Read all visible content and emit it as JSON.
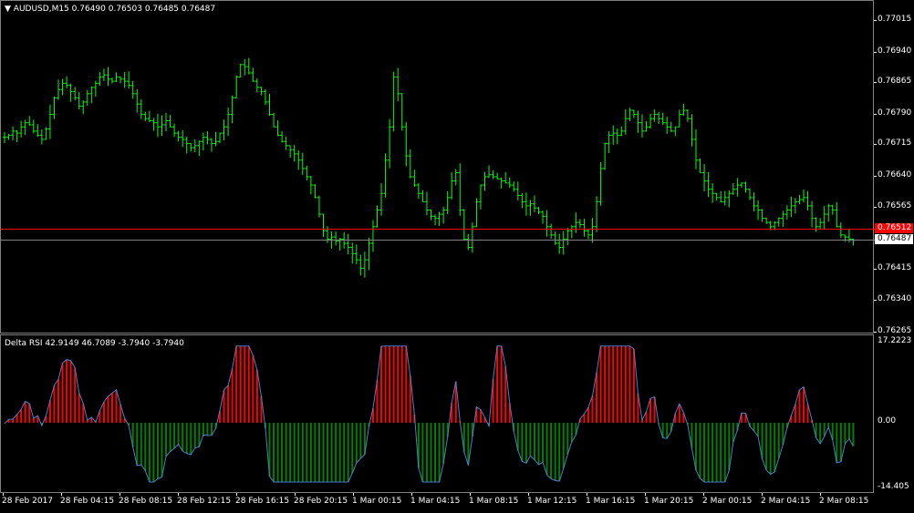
{
  "main_chart": {
    "title": "AUDUSD,M15",
    "ohlc": "0.76490 0.76503 0.76485 0.76487",
    "price_ticks": [
      "0.77015",
      "0.76940",
      "0.76865",
      "0.76790",
      "0.76715",
      "0.76640",
      "0.76565",
      "0.76415",
      "0.76340",
      "0.76265"
    ],
    "red_line_label": "0.76512",
    "bid_label": "0.76487",
    "colors": {
      "bull": "#00ff00",
      "bear": "#00ff00",
      "red_line": "#ff0000",
      "grid": "#808080"
    }
  },
  "indicator": {
    "title": "Delta RSI 42.9149 46.7089 -3.7940 -3.7940",
    "ticks": [
      "17.2223",
      "0.00",
      "-14.405"
    ],
    "colors": {
      "up": "#ff0000",
      "down": "#008000",
      "line": "#4a7fd0"
    }
  },
  "time_axis": [
    "28 Feb 2017",
    "28 Feb 04:15",
    "28 Feb 08:15",
    "28 Feb 12:15",
    "28 Feb 16:15",
    "28 Feb 20:15",
    "1 Mar 00:15",
    "1 Mar 04:15",
    "1 Mar 08:15",
    "1 Mar 12:15",
    "1 Mar 16:15",
    "1 Mar 20:15",
    "2 Mar 00:15",
    "2 Mar 04:15",
    "2 Mar 08:15"
  ],
  "chart_data": {
    "type": "bar",
    "closes": [
      0.76735,
      0.7674,
      0.7675,
      0.76745,
      0.7676,
      0.7677,
      0.76765,
      0.7675,
      0.7674,
      0.7673,
      0.76755,
      0.7679,
      0.7683,
      0.7685,
      0.76865,
      0.7686,
      0.76845,
      0.7683,
      0.7681,
      0.7682,
      0.7684,
      0.76855,
      0.76865,
      0.7688,
      0.76885,
      0.76875,
      0.7687,
      0.7688,
      0.76875,
      0.7687,
      0.7686,
      0.7684,
      0.76815,
      0.7679,
      0.7678,
      0.76775,
      0.7677,
      0.7676,
      0.76765,
      0.76775,
      0.7676,
      0.76745,
      0.76735,
      0.7673,
      0.7672,
      0.7671,
      0.76715,
      0.76725,
      0.76735,
      0.7673,
      0.7672,
      0.76725,
      0.76745,
      0.7676,
      0.7679,
      0.7683,
      0.7688,
      0.7691,
      0.76905,
      0.7689,
      0.7687,
      0.76855,
      0.76845,
      0.7682,
      0.7679,
      0.7676,
      0.7674,
      0.76725,
      0.76715,
      0.76705,
      0.76695,
      0.7668,
      0.7666,
      0.7664,
      0.7662,
      0.7659,
      0.7655,
      0.7651,
      0.7649,
      0.76495,
      0.76485,
      0.7649,
      0.7648,
      0.7647,
      0.76455,
      0.7644,
      0.7642,
      0.7644,
      0.7648,
      0.7652,
      0.7656,
      0.766,
      0.7668,
      0.7676,
      0.7688,
      0.7684,
      0.7676,
      0.7669,
      0.7664,
      0.7662,
      0.766,
      0.7658,
      0.7656,
      0.76545,
      0.7654,
      0.7655,
      0.7656,
      0.7659,
      0.7663,
      0.7665,
      0.7656,
      0.7649,
      0.7647,
      0.7652,
      0.7658,
      0.7662,
      0.7664,
      0.76645,
      0.7664,
      0.76635,
      0.7663,
      0.76625,
      0.7662,
      0.7661,
      0.76595,
      0.7658,
      0.7657,
      0.76575,
      0.76565,
      0.76555,
      0.76545,
      0.7652,
      0.765,
      0.7648,
      0.7647,
      0.7649,
      0.7651,
      0.7652,
      0.7653,
      0.76525,
      0.7651,
      0.765,
      0.7652,
      0.7658,
      0.7666,
      0.7672,
      0.7674,
      0.76745,
      0.7674,
      0.7675,
      0.7678,
      0.768,
      0.7679,
      0.7677,
      0.7675,
      0.7676,
      0.7678,
      0.7679,
      0.7678,
      0.7677,
      0.7676,
      0.7675,
      0.7676,
      0.7679,
      0.768,
      0.7678,
      0.7673,
      0.7668,
      0.7665,
      0.7663,
      0.7661,
      0.766,
      0.7659,
      0.7658,
      0.7659,
      0.766,
      0.7661,
      0.7662,
      0.76625,
      0.7661,
      0.7659,
      0.7657,
      0.7656,
      0.7654,
      0.7653,
      0.7652,
      0.7653,
      0.7654,
      0.7655,
      0.7656,
      0.7657,
      0.7658,
      0.76585,
      0.7659,
      0.7657,
      0.7654,
      0.7652,
      0.7653,
      0.7655,
      0.7657,
      0.7656,
      0.7652,
      0.765,
      0.76495,
      0.7649,
      0.76487
    ]
  }
}
